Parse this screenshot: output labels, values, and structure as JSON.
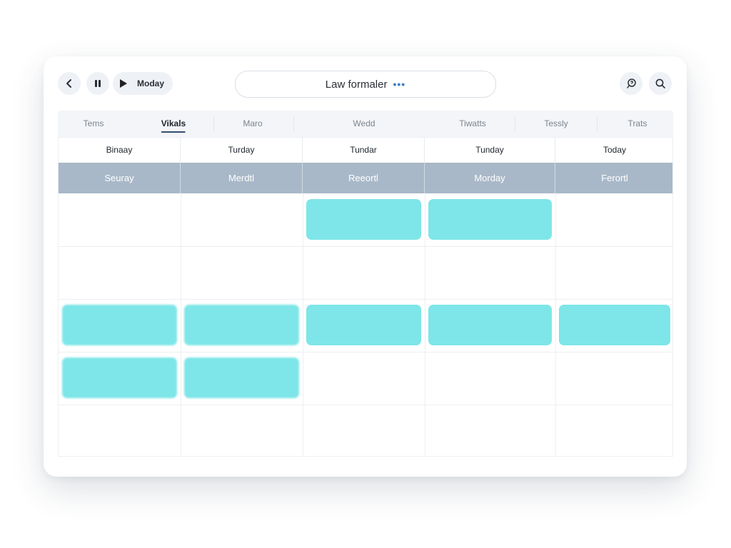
{
  "toolbar": {
    "back_icon": "chevron-left-icon",
    "pause_icon": "pause-icon",
    "play_icon": "play-icon",
    "play_label": "Moday",
    "search_text": "Law formaler",
    "search_more_icon": "more-dots-icon",
    "help_icon": "help-bubble-icon",
    "search_icon": "search-icon"
  },
  "tabs": [
    {
      "label": "Tems",
      "active": false
    },
    {
      "label": "Vikals",
      "active": true
    },
    {
      "label": "Maro",
      "active": false
    },
    {
      "label": "Wedd",
      "active": false
    },
    {
      "label": "Tiwatts",
      "active": false
    },
    {
      "label": "Tessly",
      "active": false
    },
    {
      "label": "Trats",
      "active": false
    }
  ],
  "days": [
    "Binaay",
    "Turday",
    "Tundar",
    "Tunday",
    "Today"
  ],
  "banners": [
    "Seuray",
    "Merdtl",
    "Reeortl",
    "Morday",
    "Ferortl"
  ],
  "events": [
    {
      "col": 2,
      "row": 0
    },
    {
      "col": 3,
      "row": 0
    },
    {
      "col": 0,
      "row": 2
    },
    {
      "col": 1,
      "row": 2
    },
    {
      "col": 2,
      "row": 2
    },
    {
      "col": 3,
      "row": 2
    },
    {
      "col": 4,
      "row": 2
    },
    {
      "col": 0,
      "row": 3
    },
    {
      "col": 1,
      "row": 3
    }
  ],
  "colors": {
    "event": "#7ee6e8",
    "banner": "#a9b8c8",
    "accent": "#3b7cc8"
  }
}
